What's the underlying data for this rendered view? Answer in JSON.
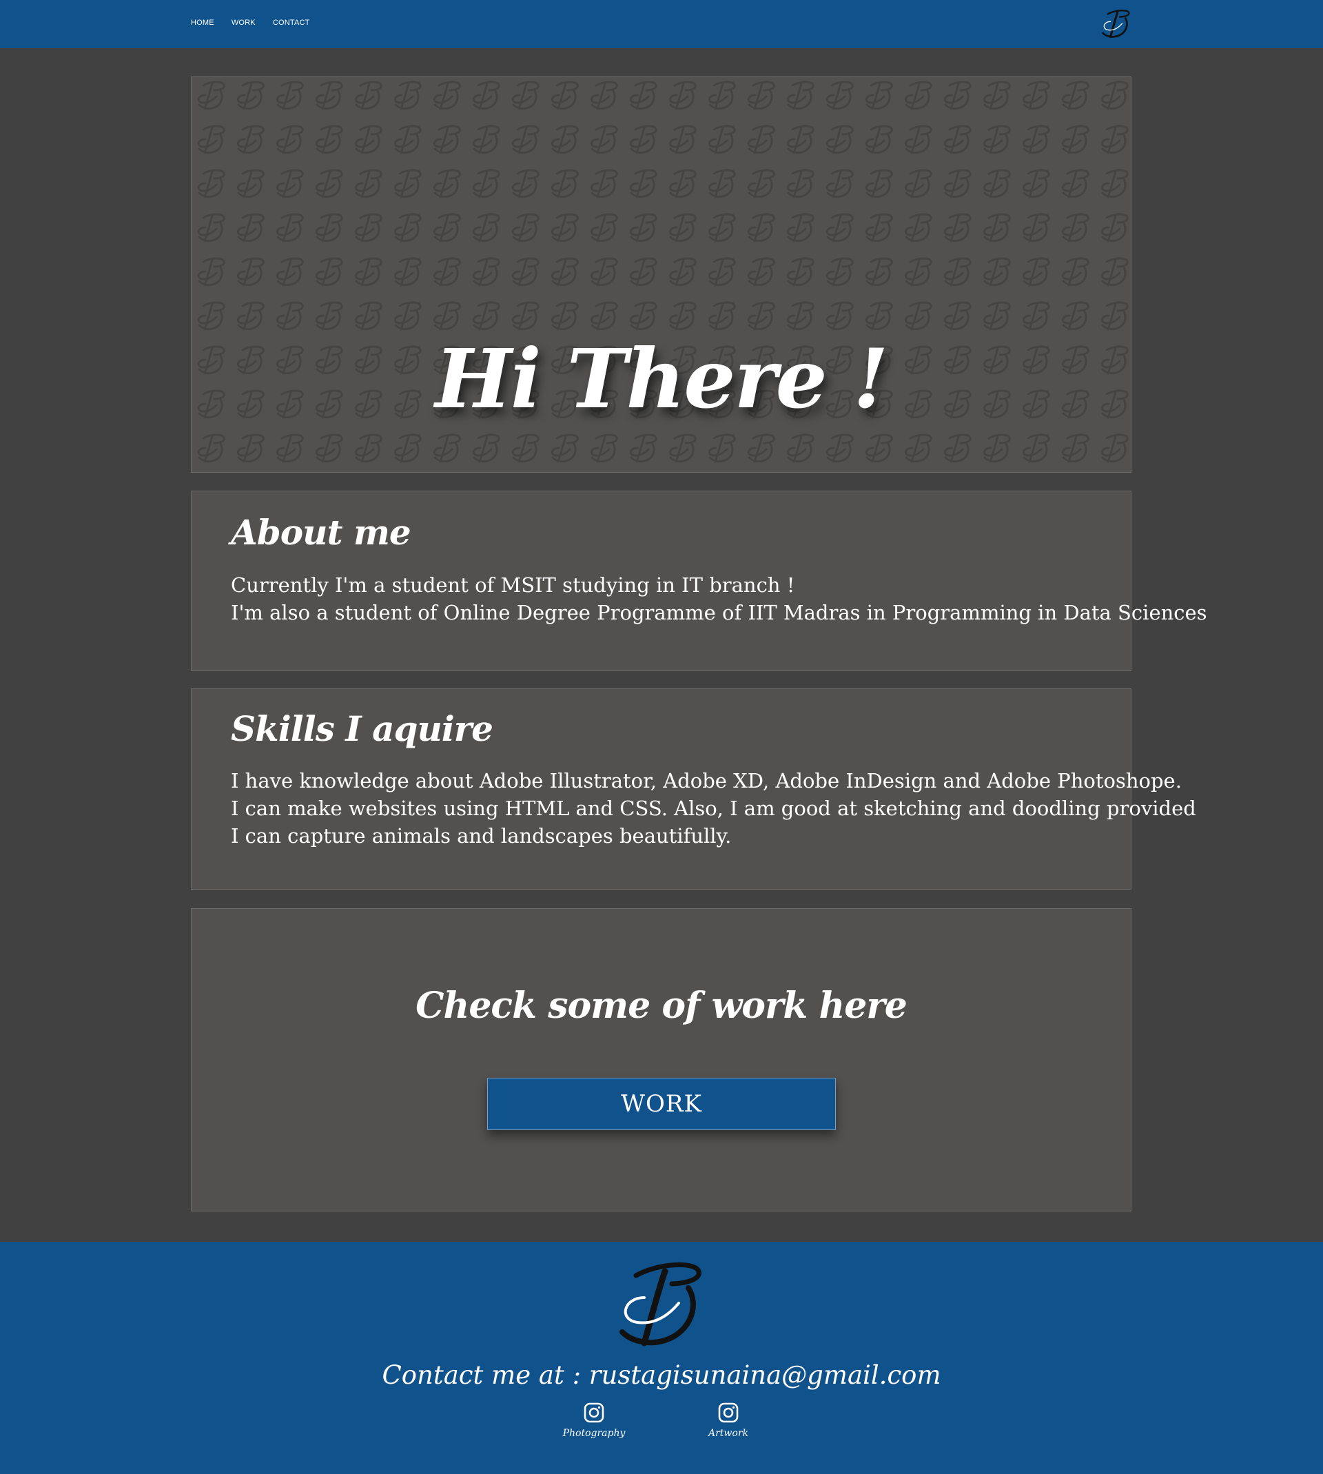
{
  "nav": {
    "items": [
      {
        "label": "HOME"
      },
      {
        "label": "WORK"
      },
      {
        "label": "CONTACT"
      }
    ],
    "logo_icon": "ds-monogram-icon"
  },
  "hero": {
    "title": "Hi There !"
  },
  "about": {
    "title": "About me",
    "lines": [
      "Currently I'm a student of MSIT studying in IT branch !",
      "I'm also a student of Online Degree Programme of IIT Madras in Programming in Data Sciences"
    ]
  },
  "skills": {
    "title": "Skills I aquire",
    "lines": [
      "I have knowledge about Adobe Illustrator, Adobe XD, Adobe InDesign and Adobe Photoshope.",
      "I can make websites using HTML and CSS. Also, I am good at sketching and doodling provided",
      "I can capture animals and landscapes beautifully."
    ]
  },
  "work": {
    "title": "Check some of work here",
    "button_label": "WORK"
  },
  "footer": {
    "contact": "Contact me at : rustagisunaina@gmail.com",
    "socials": [
      {
        "label": "Photography",
        "icon": "instagram-icon"
      },
      {
        "label": "Artwork",
        "icon": "instagram-icon"
      }
    ]
  },
  "colors": {
    "primary": "#10528b",
    "background": "#414141",
    "panel": "#525150"
  }
}
